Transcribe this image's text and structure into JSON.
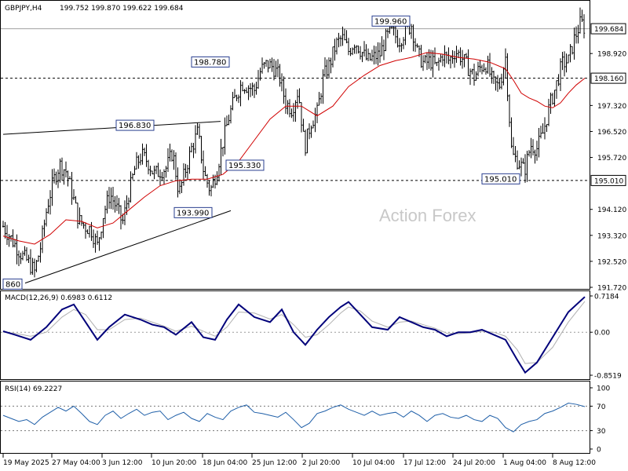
{
  "header": {
    "symbol": "GBPJPY,H4",
    "ohlc": "199.752 199.870 199.622 199.684"
  },
  "watermark": "Action Forex",
  "colors": {
    "bars": "#000000",
    "moving_average": "#d00000",
    "macd_line": "#00007a",
    "macd_signal": "#b0b0b0",
    "rsi_line": "#1f5fa8",
    "trendline": "#000000",
    "price_tag_border": "#2a3f8f"
  },
  "chart_data": [
    {
      "type": "line",
      "name": "price",
      "title": "GBPJPY,H4",
      "ylim": [
        191.72,
        200.52
      ],
      "y_ticks": [
        "199.684",
        "198.920",
        "198.160",
        "197.320",
        "196.520",
        "195.720",
        "195.010",
        "194.120",
        "193.320",
        "192.520",
        "191.720"
      ],
      "x_ticks": [
        "19 May 2025",
        "27 May 04:00",
        "3 Jun 12:00",
        "10 Jun 20:00",
        "18 Jun 04:00",
        "25 Jun 12:00",
        "2 Jul 20:00",
        "10 Jul 04:00",
        "17 Jul 12:00",
        "24 Jul 20:00",
        "1 Aug 04:00",
        "8 Aug 12:00"
      ],
      "current_price": "199.684",
      "horizontal_levels": [
        "198.160",
        "195.010"
      ],
      "annotations": [
        "860",
        "193.990",
        "196.830",
        "198.780",
        "195.330",
        "199.960",
        "195.010"
      ],
      "trendlines": {
        "upper": {
          "x": [
            0,
            277
          ],
          "y": [
            196.43,
            196.83
          ]
        },
        "lower": {
          "x": [
            28,
            290
          ],
          "y": [
            191.85,
            194.08
          ]
        }
      },
      "series": [
        {
          "x": [
            0,
            8,
            16,
            24,
            32,
            40,
            48,
            56,
            64,
            72,
            80,
            88,
            96,
            104,
            112,
            120,
            128,
            136,
            144,
            152,
            160,
            168,
            176,
            184,
            192,
            200,
            208,
            216,
            224,
            232,
            240,
            248,
            256,
            264,
            272,
            280,
            288,
            296,
            304,
            312,
            320,
            328,
            336,
            344,
            352,
            360,
            368,
            376,
            384,
            392,
            400,
            408,
            416,
            424,
            432,
            440,
            448,
            456,
            464,
            472,
            480,
            488,
            496,
            504,
            512,
            520,
            528,
            536,
            544,
            552,
            560,
            568,
            576,
            584,
            592,
            600,
            608,
            616,
            624,
            632,
            640,
            648,
            656,
            664,
            672,
            680,
            688,
            696,
            704,
            712,
            720,
            728,
            736,
            741
          ],
          "values": [
            193.6,
            193.3,
            193.0,
            192.7,
            192.5,
            192.2,
            193.0,
            194.2,
            195.0,
            195.5,
            195.3,
            194.6,
            193.8,
            193.6,
            193.5,
            193.0,
            194.0,
            194.6,
            194.2,
            193.7,
            194.6,
            195.4,
            195.8,
            195.6,
            195.2,
            195.3,
            195.4,
            195.9,
            194.6,
            195.3,
            196.0,
            196.5,
            195.2,
            194.7,
            195.3,
            196.2,
            197.0,
            197.6,
            198.0,
            197.9,
            197.8,
            198.4,
            198.6,
            198.5,
            198.2,
            197.4,
            197.2,
            197.8,
            196.0,
            196.8,
            197.1,
            198.2,
            198.6,
            199.2,
            199.4,
            199.0,
            199.3,
            199.0,
            198.7,
            198.8,
            198.9,
            199.4,
            199.6,
            199.3,
            199.6,
            199.8,
            198.9,
            198.6,
            198.7,
            198.5,
            198.9,
            198.7,
            199.0,
            198.8,
            198.5,
            198.2,
            198.5,
            198.6,
            198.0,
            197.9,
            198.8,
            195.8,
            195.6,
            195.3,
            196.1,
            196.0,
            196.5,
            197.3,
            197.9,
            198.6,
            198.7,
            199.4,
            199.9,
            199.68
          ]
        },
        {
          "name": "MA",
          "x": [
            0,
            20,
            40,
            60,
            80,
            100,
            120,
            140,
            160,
            180,
            200,
            220,
            240,
            260,
            280,
            300,
            320,
            340,
            360,
            380,
            400,
            420,
            440,
            460,
            480,
            500,
            520,
            540,
            560,
            580,
            600,
            620,
            640,
            650,
            660,
            670,
            680,
            690,
            700,
            710,
            720,
            730,
            741
          ],
          "values": [
            193.3,
            193.15,
            193.05,
            193.35,
            193.8,
            193.75,
            193.55,
            193.7,
            194.1,
            194.5,
            194.85,
            195.0,
            195.05,
            195.05,
            195.2,
            195.6,
            196.25,
            196.9,
            197.3,
            197.3,
            197.0,
            197.3,
            197.9,
            198.25,
            198.55,
            198.7,
            198.8,
            198.95,
            198.9,
            198.8,
            198.75,
            198.65,
            198.45,
            198.1,
            197.7,
            197.55,
            197.45,
            197.3,
            197.25,
            197.4,
            197.7,
            197.95,
            198.16
          ]
        }
      ]
    },
    {
      "type": "line",
      "title": "MACD(12,26,9) 0.6983 0.6112",
      "ylim": [
        -0.8519,
        0.7184
      ],
      "y_ticks": [
        "0.7184",
        "0.00",
        "-0.8519"
      ],
      "series": [
        {
          "name": "MACD",
          "x": [
            0,
            15,
            35,
            55,
            75,
            90,
            105,
            120,
            135,
            155,
            175,
            190,
            205,
            220,
            240,
            255,
            270,
            285,
            300,
            320,
            340,
            355,
            370,
            385,
            400,
            415,
            430,
            440,
            455,
            470,
            490,
            505,
            520,
            535,
            550,
            565,
            580,
            595,
            610,
            625,
            640,
            655,
            665,
            680,
            700,
            720,
            741
          ],
          "values": [
            0.02,
            -0.05,
            -0.15,
            0.1,
            0.45,
            0.55,
            0.2,
            -0.15,
            0.1,
            0.35,
            0.25,
            0.15,
            0.1,
            -0.05,
            0.2,
            -0.1,
            -0.15,
            0.25,
            0.55,
            0.3,
            0.2,
            0.45,
            0.0,
            -0.25,
            0.05,
            0.3,
            0.5,
            0.6,
            0.35,
            0.1,
            0.05,
            0.3,
            0.2,
            0.1,
            0.05,
            -0.08,
            0.0,
            0.0,
            0.05,
            -0.05,
            -0.15,
            -0.55,
            -0.8,
            -0.6,
            -0.1,
            0.4,
            0.7
          ]
        },
        {
          "name": "Signal",
          "x": [
            0,
            15,
            35,
            55,
            75,
            90,
            105,
            120,
            135,
            155,
            175,
            190,
            205,
            220,
            240,
            255,
            270,
            285,
            300,
            320,
            340,
            355,
            370,
            385,
            400,
            415,
            430,
            440,
            455,
            470,
            490,
            505,
            520,
            535,
            550,
            565,
            580,
            595,
            610,
            625,
            640,
            655,
            665,
            680,
            700,
            720,
            741
          ],
          "values": [
            0.0,
            -0.02,
            -0.08,
            0.0,
            0.3,
            0.45,
            0.35,
            0.05,
            0.05,
            0.25,
            0.28,
            0.2,
            0.12,
            0.02,
            0.12,
            0.02,
            -0.08,
            0.1,
            0.4,
            0.38,
            0.26,
            0.35,
            0.15,
            -0.1,
            -0.05,
            0.15,
            0.38,
            0.5,
            0.42,
            0.22,
            0.1,
            0.2,
            0.22,
            0.15,
            0.08,
            -0.02,
            -0.03,
            -0.01,
            0.02,
            0.0,
            -0.08,
            -0.35,
            -0.62,
            -0.6,
            -0.3,
            0.2,
            0.61
          ]
        }
      ]
    },
    {
      "type": "line",
      "title": "RSI(14) 69.2227",
      "ylim": [
        0,
        100
      ],
      "y_ticks": [
        "100",
        "70",
        "30",
        "0"
      ],
      "series": [
        {
          "name": "RSI",
          "x": [
            0,
            10,
            20,
            30,
            40,
            50,
            60,
            70,
            80,
            90,
            100,
            110,
            120,
            130,
            140,
            150,
            160,
            170,
            180,
            190,
            200,
            210,
            220,
            230,
            240,
            250,
            260,
            270,
            280,
            290,
            300,
            310,
            320,
            330,
            340,
            350,
            360,
            370,
            380,
            390,
            400,
            410,
            420,
            430,
            440,
            450,
            460,
            470,
            480,
            490,
            500,
            510,
            520,
            530,
            540,
            550,
            560,
            570,
            580,
            590,
            600,
            610,
            620,
            630,
            640,
            650,
            660,
            670,
            680,
            690,
            700,
            710,
            720,
            730,
            741
          ],
          "values": [
            55,
            50,
            45,
            48,
            40,
            52,
            60,
            68,
            62,
            70,
            58,
            45,
            40,
            55,
            62,
            50,
            58,
            65,
            55,
            60,
            62,
            48,
            55,
            60,
            50,
            45,
            58,
            52,
            48,
            62,
            68,
            72,
            60,
            58,
            55,
            52,
            60,
            48,
            35,
            42,
            58,
            62,
            68,
            72,
            65,
            60,
            55,
            62,
            55,
            58,
            60,
            52,
            62,
            55,
            45,
            55,
            58,
            52,
            50,
            55,
            48,
            45,
            55,
            50,
            35,
            28,
            40,
            45,
            48,
            58,
            62,
            68,
            75,
            73,
            69.2
          ]
        }
      ]
    }
  ]
}
